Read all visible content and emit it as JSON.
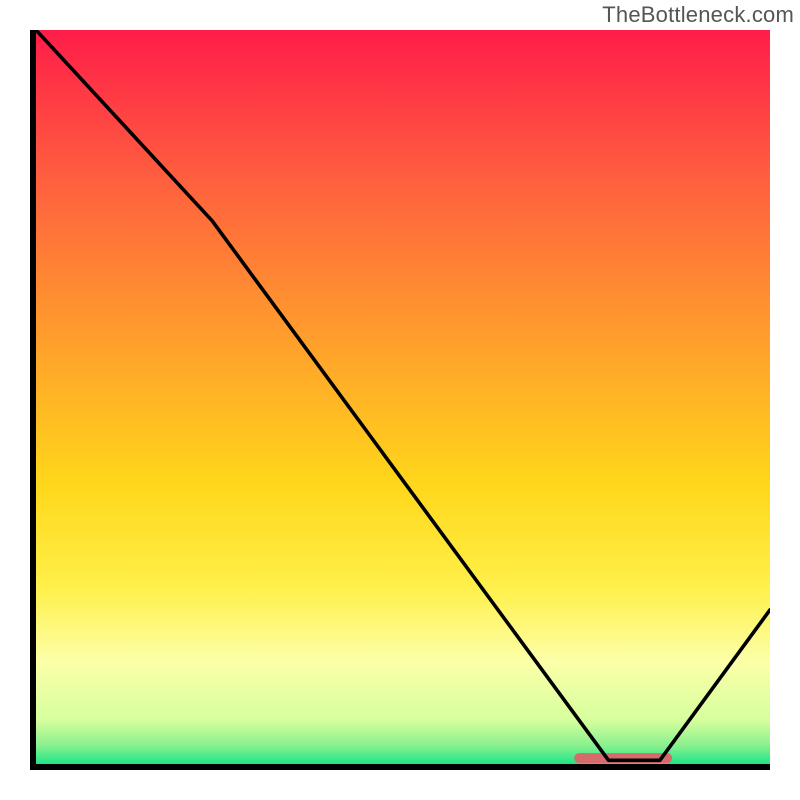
{
  "watermark": {
    "text": "TheBottleneck.com"
  },
  "chart_data": {
    "type": "line",
    "title": "",
    "xlabel": "",
    "ylabel": "",
    "xlim": [
      0,
      100
    ],
    "ylim": [
      0,
      100
    ],
    "grid": false,
    "series": [
      {
        "name": "bottleneck-curve",
        "x": [
          0,
          24,
          78,
          85,
          100
        ],
        "y": [
          100,
          74,
          0.5,
          0.5,
          21
        ]
      }
    ],
    "annotations": [
      {
        "name": "optimal-range-marker",
        "x_start": 74,
        "x_end": 86,
        "y": 0.8,
        "color": "#d66b6c"
      }
    ],
    "gradient_background": {
      "stops": [
        {
          "offset": 0.0,
          "color": "#ff1d49"
        },
        {
          "offset": 0.2,
          "color": "#ff5e3f"
        },
        {
          "offset": 0.42,
          "color": "#ff9e2c"
        },
        {
          "offset": 0.62,
          "color": "#ffd71a"
        },
        {
          "offset": 0.76,
          "color": "#fff04a"
        },
        {
          "offset": 0.86,
          "color": "#fcffa8"
        },
        {
          "offset": 0.94,
          "color": "#d6ff9e"
        },
        {
          "offset": 0.975,
          "color": "#8af08e"
        },
        {
          "offset": 1.0,
          "color": "#1de587"
        }
      ]
    }
  }
}
